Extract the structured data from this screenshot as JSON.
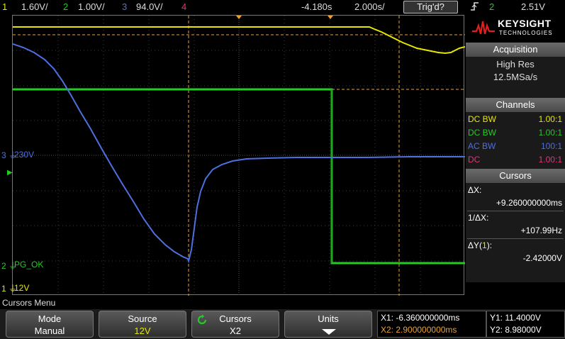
{
  "colors": {
    "ch1": "#e6e600",
    "ch2": "#22cc22",
    "ch3": "#4d6fe0",
    "ch4": "#e8307a",
    "cursor": "#f0a030",
    "grid": "#555555"
  },
  "topbar": {
    "ch1_num": "1",
    "ch1_scale": "1.60V/",
    "ch2_num": "2",
    "ch2_scale": "1.00V/",
    "ch3_num": "3",
    "ch3_scale": "94.0V/",
    "ch4_num": "4",
    "time_offset": "-4.180s",
    "time_scale": "2.000s/",
    "trigger_status": "Trig'd?",
    "trigger_icon": "rising-edge-icon",
    "trigger_source": "2",
    "trigger_level": "2.51V"
  },
  "scope": {
    "ch3_marker_label": "3",
    "ch3_level_label": "230V",
    "ch2_marker_label": "2",
    "ch2_level_label": "PG_OK",
    "ch1_marker_label": "1",
    "ch1_level_label": "12V"
  },
  "panel": {
    "brand": "KEYSIGHT",
    "brand_sub": "TECHNOLOGIES",
    "acq_title": "Acquisition",
    "acq_mode": "High Res",
    "acq_rate": "12.5MSa/s",
    "channels_title": "Channels",
    "channels": [
      {
        "coupling": "DC BW",
        "ratio": "1.00:1"
      },
      {
        "coupling": "DC BW",
        "ratio": "1.00:1"
      },
      {
        "coupling": "AC BW",
        "ratio": "100:1"
      },
      {
        "coupling": "DC",
        "ratio": "1.00:1"
      }
    ],
    "cursors_title": "Cursors",
    "dx_label": "ΔX:",
    "dx_value": "+9.260000000ms",
    "inv_dx_label": "1/ΔX:",
    "inv_dx_value": "+107.99Hz",
    "dy_label_pre": "ΔY(",
    "dy_label_ch": "1",
    "dy_label_post": "):",
    "dy_value": "-2.42000V"
  },
  "menu": {
    "title": "Cursors Menu",
    "softkeys": [
      {
        "label": "Mode",
        "value": "Manual"
      },
      {
        "label": "Source",
        "value": "12V"
      },
      {
        "label": "Cursors",
        "value": "X2"
      },
      {
        "label": "Units",
        "value": ""
      }
    ]
  },
  "readout": {
    "x1": "X1: -6.360000000ms",
    "x2": "X2: 2.900000000ms",
    "y1": "Y1: 11.4000V",
    "y2": "Y2: 8.98000V"
  }
}
